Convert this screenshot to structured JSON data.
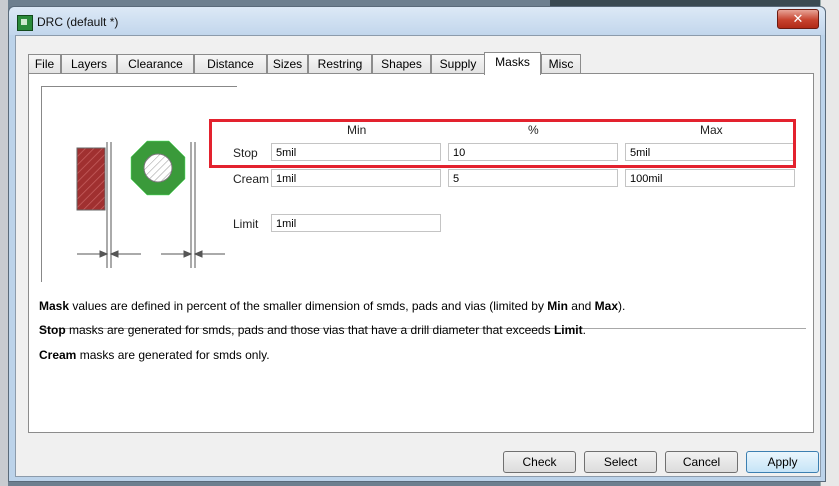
{
  "window": {
    "title": "DRC (default *)",
    "close_label": "✕"
  },
  "tabs": [
    {
      "label": "File",
      "active": false
    },
    {
      "label": "Layers",
      "active": false
    },
    {
      "label": "Clearance",
      "active": false
    },
    {
      "label": "Distance",
      "active": false
    },
    {
      "label": "Sizes",
      "active": false
    },
    {
      "label": "Restring",
      "active": false
    },
    {
      "label": "Shapes",
      "active": false
    },
    {
      "label": "Supply",
      "active": false
    },
    {
      "label": "Masks",
      "active": true
    },
    {
      "label": "Misc",
      "active": false
    }
  ],
  "masks": {
    "headers": {
      "min": "Min",
      "percent": "%",
      "max": "Max"
    },
    "stop": {
      "label": "Stop",
      "min": "5mil",
      "percent": "10",
      "max": "5mil"
    },
    "cream": {
      "label": "Cream",
      "min": "1mil",
      "percent": "5",
      "max": "100mil"
    },
    "limit": {
      "label": "Limit",
      "value": "1mil"
    }
  },
  "info": {
    "line1": {
      "b1": "Mask",
      "t1": " values are defined in percent of the smaller dimension of smds, pads and vias (limited by ",
      "b2": "Min",
      "t2": " and ",
      "b3": "Max",
      "t3": ")."
    },
    "line2": {
      "b1": "Stop",
      "t1": " masks are generated for smds, pads and those vias that have a drill diameter that exceeds ",
      "b2": "Limit",
      "t2": "."
    },
    "line3": {
      "b1": "Cream",
      "t1": " masks are generated for smds only."
    }
  },
  "buttons": {
    "check": "Check",
    "select": "Select",
    "cancel": "Cancel",
    "apply": "Apply"
  },
  "colors": {
    "smd_fill": "#a03030",
    "pad_fill": "#3a9a3a",
    "highlight": "#e3222e"
  }
}
